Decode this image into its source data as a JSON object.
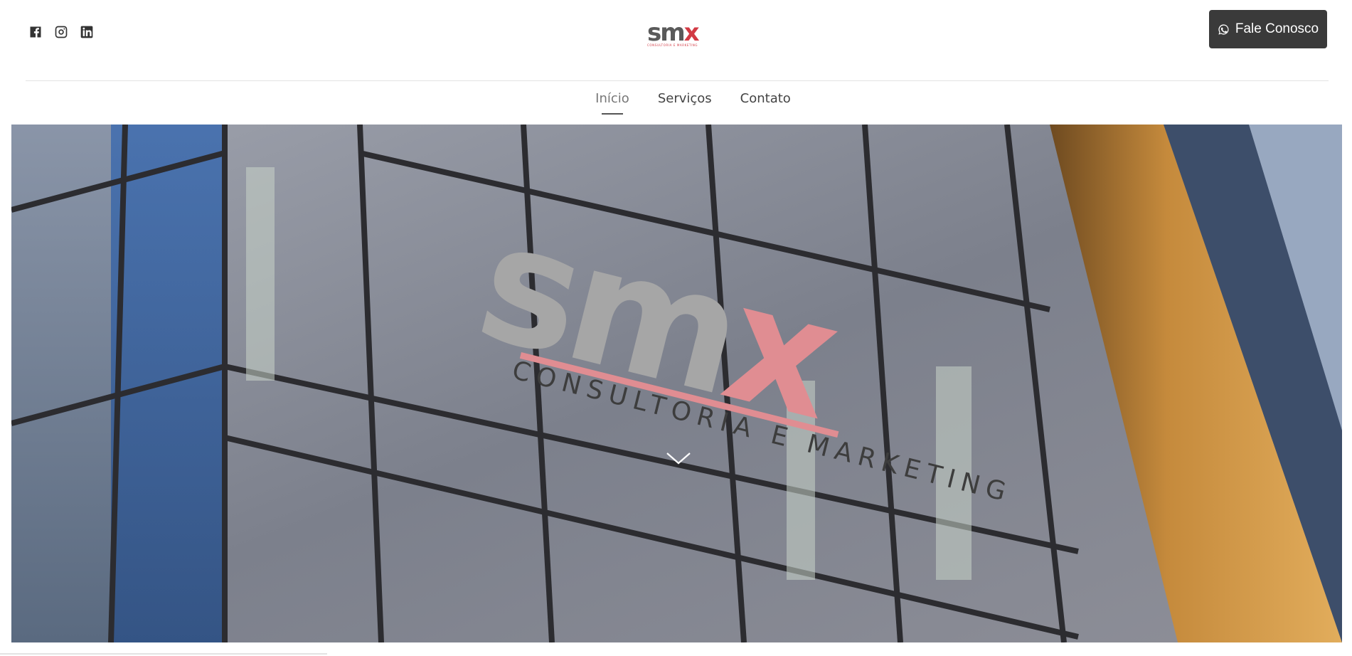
{
  "header": {
    "social": [
      {
        "name": "facebook-icon"
      },
      {
        "name": "instagram-icon"
      },
      {
        "name": "linkedin-icon"
      }
    ],
    "logo": {
      "word_main": "sm",
      "word_accent": "x"
    },
    "cta_label": "Fale Conosco",
    "cta_icon": "whatsapp-icon"
  },
  "nav": {
    "items": [
      {
        "label": "Início",
        "active": true
      },
      {
        "label": "Serviços",
        "active": false
      },
      {
        "label": "Contato",
        "active": false
      }
    ]
  },
  "hero": {
    "sign_main": "sm",
    "sign_accent": "x",
    "sign_tagline": "CONSULTORIA E MARKETING",
    "scroll_icon": "chevron-down-icon"
  },
  "colors": {
    "brand_red": "#d23a44",
    "cta_bg": "#3a3a3a",
    "sign_pink": "#e08d92"
  }
}
